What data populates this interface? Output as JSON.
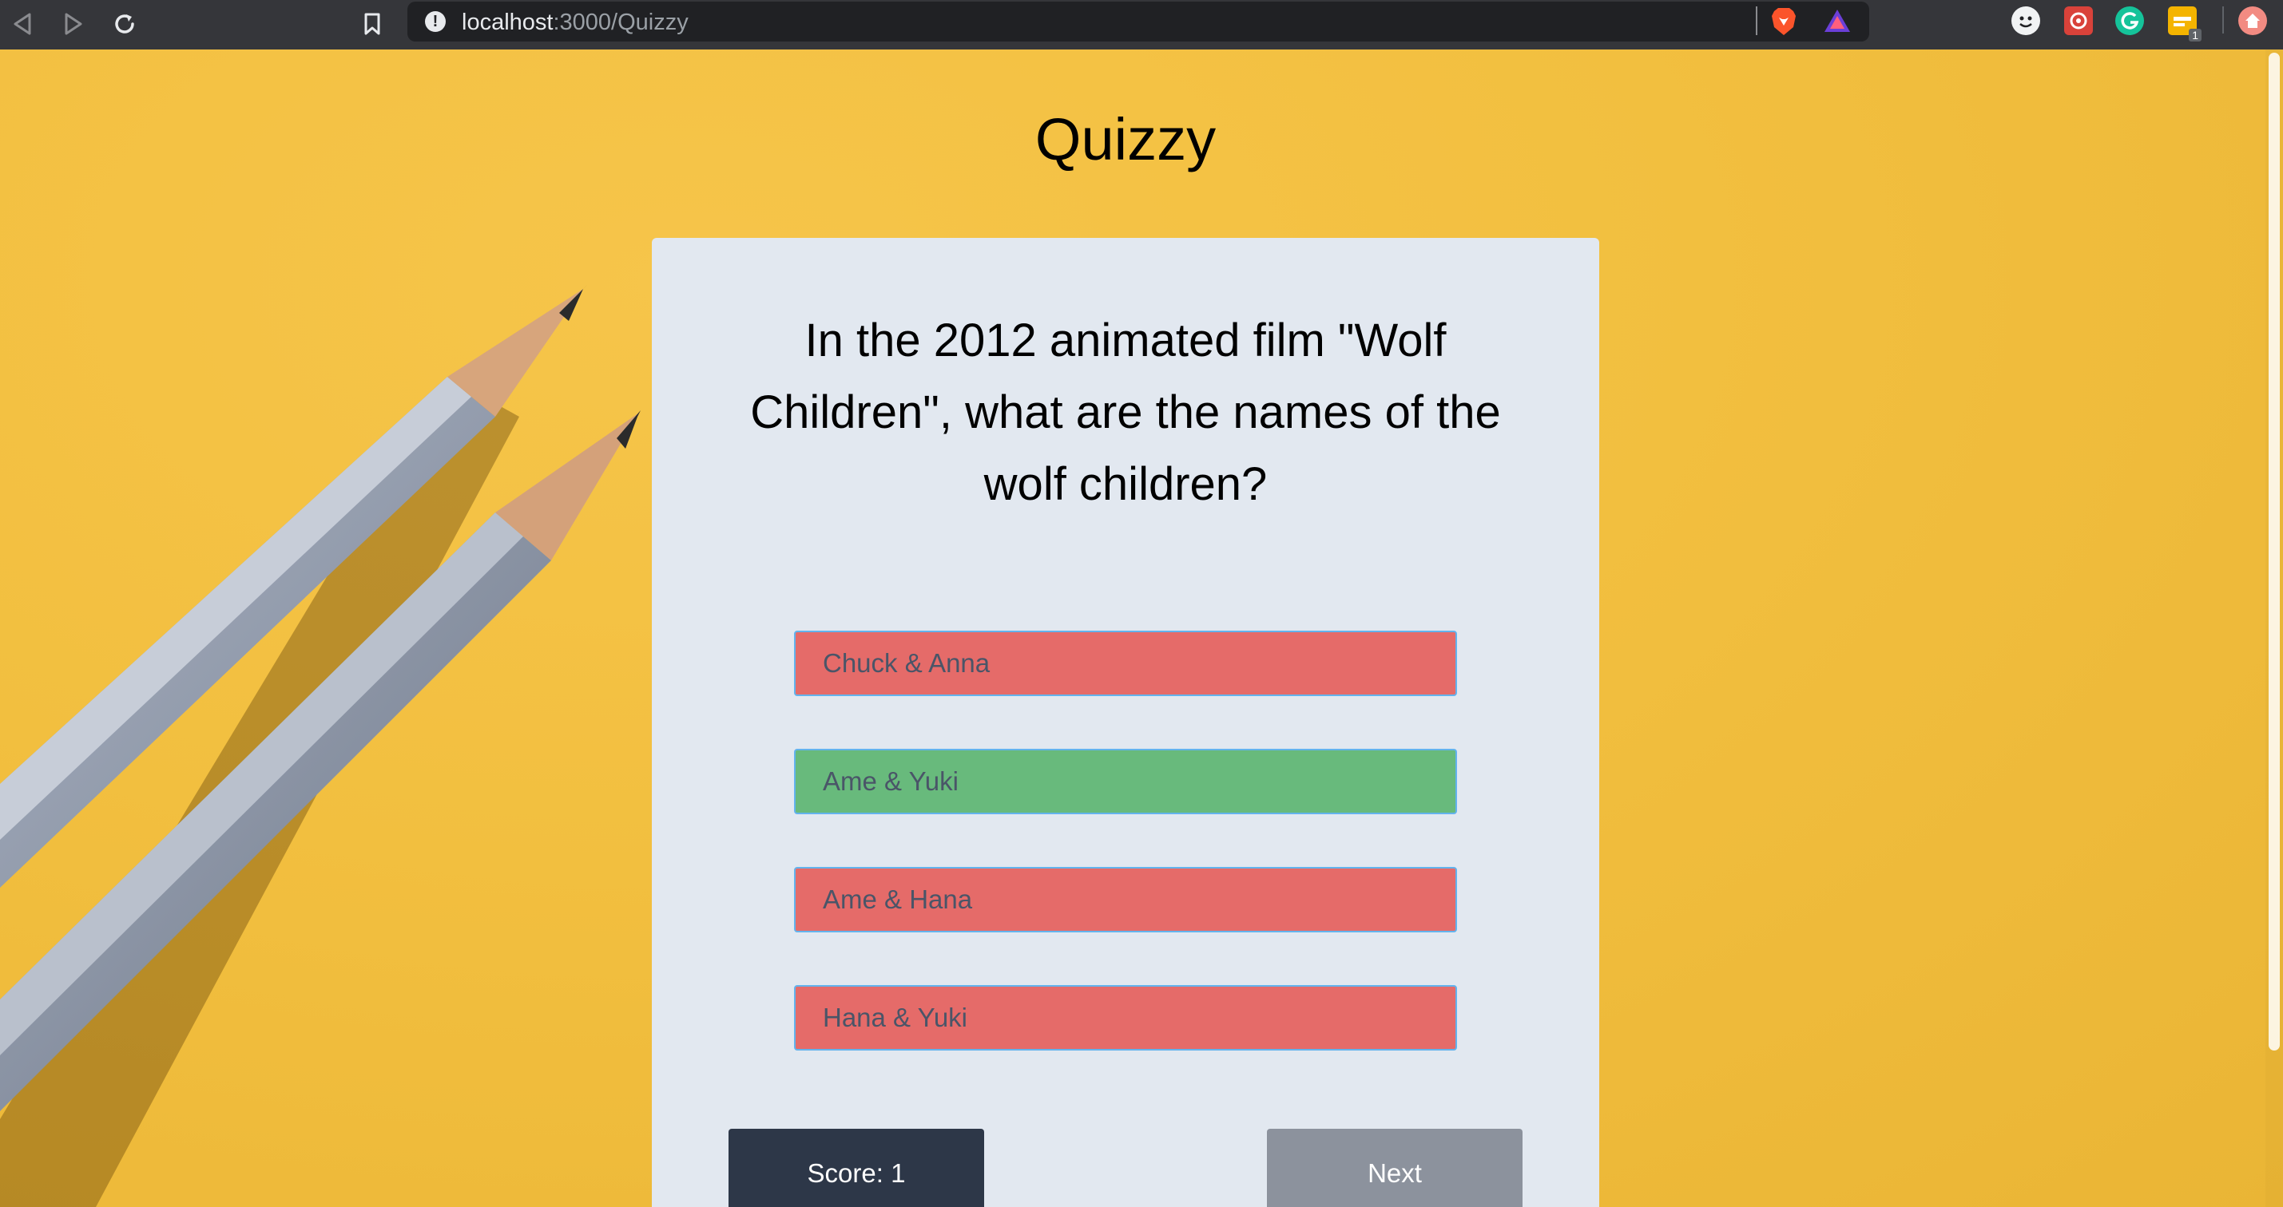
{
  "browser": {
    "url_host": "localhost",
    "url_path": ":3000/Quizzy",
    "extension_badge": "1"
  },
  "page": {
    "title": "Quizzy"
  },
  "quiz": {
    "question": "In the 2012 animated film \"Wolf Children\", what are the names of the wolf children?",
    "answers": [
      {
        "label": "Chuck & Anna",
        "state": "incorrect"
      },
      {
        "label": "Ame & Yuki",
        "state": "correct"
      },
      {
        "label": "Ame & Hana",
        "state": "incorrect"
      },
      {
        "label": "Hana & Yuki",
        "state": "incorrect"
      }
    ],
    "score_label": "Score: 1",
    "next_label": "Next"
  },
  "colors": {
    "background": "#f2bf3f",
    "card": "#e2e8f0",
    "answer_correct": "#68ba7c",
    "answer_incorrect": "#e56b69",
    "score_button": "#2d3748",
    "next_button": "#8c929d"
  }
}
